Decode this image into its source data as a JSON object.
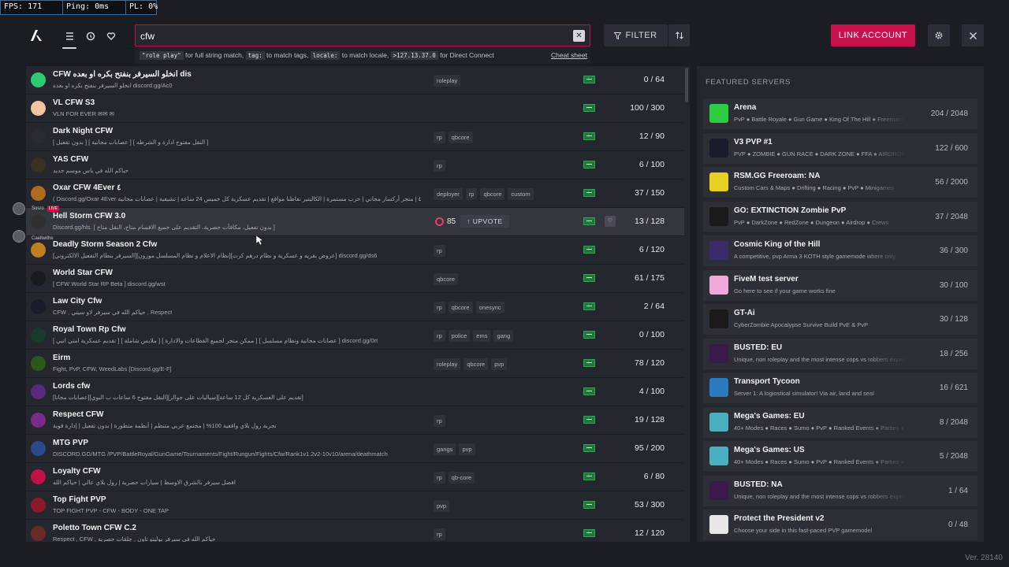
{
  "perf": {
    "fps": "FPS: 171",
    "ping": "Ping: 0ms",
    "pl": "PL: 0%"
  },
  "search": {
    "value": "cfw",
    "clear": "✕",
    "hints": {
      "q1": "\"role play\"",
      "t1": " for full string match, ",
      "q2": "tag:",
      "t2": " to match tags, ",
      "q3": "locale:",
      "t3": " to match locale, ",
      "q4": ">127.13.37.0",
      "t4": " for Direct Connect",
      "cheat": "Cheat sheet"
    }
  },
  "toolbar": {
    "filter": "FILTER",
    "link_account": "LINK ACCOUNT"
  },
  "servers": [
    {
      "name": "CFW انخلو السيرفر بنفتح بكره او بعده dis",
      "desc": "انخلو السيرفر بنفتح بكره او بعده discord.gg/Ac0",
      "tags": [
        "roleplay"
      ],
      "players": "0 / 64",
      "icon_color": "#2ecc71",
      "icon_name": "spade-icon"
    },
    {
      "name": "VL CFW S3",
      "desc": "VLN FOR EVER ✉✉ ✉",
      "tags": [],
      "players": "100 / 300",
      "icon_color": "#f0c8a0",
      "icon_name": "gradient-icon"
    },
    {
      "name": "Dark Night CFW",
      "desc": "[ بدون تفعيل ] [ عصابات مجانية ] [ النقل مفتوح ادارة و الشرطه ]",
      "tags": [
        "rp",
        "qbcore"
      ],
      "players": "12 / 90",
      "icon_color": "#2a2a30",
      "icon_name": "dn-logo-icon"
    },
    {
      "name": "YAS CFW",
      "desc": "حياكم الله في ياس موسم جديد",
      "tags": [
        "rp"
      ],
      "players": "6 / 100",
      "icon_color": "#3a3220",
      "icon_name": "yas-logo-icon"
    },
    {
      "name": "Oxar CFW 4Ever ٤",
      "desc": "( Discord.gg/Oxar 4Ever ٤ | متجر أركسار مجاني | حرب مستمرة | الكاليتير نقاطنا مواقع | تقديم عسكرية كل خميس 24 ساعة | تشيفية | عصابات مجانية",
      "tags": [
        "deployer",
        "rp",
        "qbcore",
        "custom"
      ],
      "players": "37 / 150",
      "icon_color": "#b06a20",
      "icon_name": "oxar-logo-icon"
    },
    {
      "name": "Hell Storm CFW 3.0",
      "desc": "Discord.gg/hls. [ بدون تفعيل، مكافأت حصرية، التقديم على جميع الاقسام متاح، النقل متاح ]",
      "tags": [],
      "players": "13 / 128",
      "icon_color": "#303030",
      "icon_name": "hellstorm-logo-icon",
      "boost": "85",
      "upvote": "UPVOTE",
      "highlight": true
    },
    {
      "name": "Deadly Storm Season 2 Cfw",
      "desc": "[السيرفر بنظام التفعيل الالكتروني][نظام الاعلام و نظام المسلسل موزون][عروض بقريه و عسكرية و نظام درهم كرت] discord.gg/ds6",
      "tags": [
        "rp"
      ],
      "players": "6 / 120",
      "icon_color": "#c08020",
      "icon_name": "deadly-storm-logo-icon"
    },
    {
      "name": "World Star CFW",
      "desc": "[ CFW World Star RP Beta ] discord.gg/wst",
      "tags": [
        "qbcore"
      ],
      "players": "61 / 175",
      "icon_color": "#1a1a1a",
      "icon_name": "world-star-logo-icon"
    },
    {
      "name": "Law City Cfw",
      "desc": "CFW , حياكم الله في سيرفر لاو سيتي , Respect",
      "tags": [
        "rp",
        "qbcore",
        "onesync"
      ],
      "players": "2 / 64",
      "icon_color": "#1a1a2a",
      "icon_name": "law-city-logo-icon"
    },
    {
      "name": "Royal Town Rp Cfw",
      "desc": "[ تقديم عسكرية امني انبي ] [ ملابس شاملة ] [ ممكن متجر لجميع القطاعات والادارة ] [ عصابات مجانية ونظام مسلسل ] discord.gg/0rt",
      "tags": [
        "rp",
        "police",
        "ems",
        "gang"
      ],
      "players": "0 / 100",
      "icon_color": "#1a3a2a",
      "icon_name": "royal-town-logo-icon"
    },
    {
      "name": "Eirm",
      "desc": "Fight, PvP, CFW, WeedLabs [Discord.gg/E-F]",
      "tags": [
        "roleplay",
        "qbcore",
        "pvp"
      ],
      "players": "78 / 120",
      "icon_color": "#2a5a1a",
      "icon_name": "eirm-logo-icon"
    },
    {
      "name": "Lords cfw",
      "desc": "[عصابات مجانا][النقل مفتوح 6 ساعات ب البوي][سياليات على جوالز][تقديم على العسكرية كل 12 ساعة]",
      "tags": [],
      "players": "4 / 100",
      "icon_color": "#5a2a7a",
      "icon_name": "lords-logo-icon"
    },
    {
      "name": "Respect CFW",
      "desc": "تجربة رول بلاي واقعية 100% | مجتمع عربي متنظم | أنظمة متطورة | بدون تفعيل | إدارة قوية",
      "tags": [
        "rp"
      ],
      "players": "19 / 128",
      "icon_color": "#7a2a8a",
      "icon_name": "respect-logo-icon"
    },
    {
      "name": "MTG PVP",
      "desc": "DISCORD.GG/MTG /PVP/BattleRoyal/GunGame/Tournaments/Fight/Rungun/Fights/Cfw/Rank1v1.2v2-10v10/arena/deathmatch",
      "tags": [
        "gangs",
        "pvp"
      ],
      "players": "95 / 200",
      "icon_color": "#2a4a8a",
      "icon_name": "mtg-logo-icon"
    },
    {
      "name": "Loyalty CFW",
      "desc": "افضل سيرفر بالشرق الاوسط | سيارات حصرية | رول بلاي عالي | حياكم الله",
      "tags": [
        "rp",
        "qb-core"
      ],
      "players": "6 / 80",
      "icon_color": "#c0104a",
      "icon_name": "loyalty-logo-icon"
    },
    {
      "name": "Top Fight PVP",
      "desc": "TOP FIGHT PVP - CFW - BODY - ONE TAP",
      "tags": [
        "pvp"
      ],
      "players": "53 / 300",
      "icon_color": "#8a1a2a",
      "icon_name": "top-fight-logo-icon"
    },
    {
      "name": "Poletto Town CFW C.2",
      "desc": "Respect , CFW , حياكم الله في سيرفر بوليتو تاون , جلقات حصرية",
      "tags": [
        "rp"
      ],
      "players": "12 / 120",
      "icon_color": "#6a2a2a",
      "icon_name": "poletto-logo-icon"
    }
  ],
  "featured": {
    "title": "FEATURED SERVERS",
    "items": [
      {
        "name": "Arena",
        "desc": "PvP ● Battle Royale ● Gun Game ● King Of The Hill ● Freeroam",
        "players": "204 / 2048",
        "icon_color": "#2ecc40",
        "icon_name": "arena-logo-icon"
      },
      {
        "name": "V3 PVP #1",
        "desc": "PVP ● ZOMBIE ● GUN RACE ● DARK ZONE ● FFA ● AIRDROP",
        "players": "122 / 600",
        "icon_color": "#1a1a2a",
        "icon_name": "v3-logo-icon"
      },
      {
        "name": "RSM.GG Freeroam: NA",
        "desc": "Custom Cars & Maps ● Drifting ● Racing ● PvP ● Minigames",
        "players": "56 / 2000",
        "icon_color": "#e8d020",
        "icon_name": "rsm-logo-icon"
      },
      {
        "name": "GO: EXTINCTION Zombie PvP",
        "desc": "PvP ● DarkZone ● RedZone ● Dungeon ● Airdrop ● Crews",
        "players": "37 / 2048",
        "icon_color": "#1a1a1a",
        "icon_name": "go-extinction-logo-icon"
      },
      {
        "name": "Cosmic King of the Hill",
        "desc": "A competitive, pvp Arma 3 KOTH style gamemode where only",
        "players": "36 / 300",
        "icon_color": "#3a2a6a",
        "icon_name": "cosmic-logo-icon"
      },
      {
        "name": "FiveM test server",
        "desc": "Go here to see if your game works fine",
        "players": "30 / 100",
        "icon_color": "#f0a8d8",
        "icon_name": "fivem-logo-icon"
      },
      {
        "name": "GT-Ai",
        "desc": "CyberZombie Apocalypse Survive Build PvE & PvP",
        "players": "30 / 128",
        "icon_color": "#1a1a1a",
        "icon_name": "gt-ai-logo-icon"
      },
      {
        "name": "BUSTED: EU",
        "desc": "Unique, non roleplay and the most intense cops vs robbers experience",
        "players": "18 / 256",
        "icon_color": "#3a1a4a",
        "icon_name": "busted-logo-icon"
      },
      {
        "name": "Transport Tycoon",
        "desc": "Server 1: A logiostical simulator! Via air, land and seal",
        "players": "16 / 621",
        "icon_color": "#2a7ac0",
        "icon_name": "transport-tycoon-logo-icon"
      },
      {
        "name": "Mega's Games: EU",
        "desc": "40+ Modes ● Races ● Sumo ● PvP ● Ranked Events ● Parties ●",
        "players": "8 / 2048",
        "icon_color": "#4ab0c0",
        "icon_name": "megas-games-logo-icon"
      },
      {
        "name": "Mega's Games: US",
        "desc": "40+ Modes ● Races ● Sumo ● PvP ● Ranked Events ● Parties ●",
        "players": "5 / 2048",
        "icon_color": "#4ab0c0",
        "icon_name": "megas-games-logo-icon"
      },
      {
        "name": "BUSTED: NA",
        "desc": "Unique, non roleplay and the most intense cops vs robbers experience",
        "players": "1 / 64",
        "icon_color": "#3a1a4a",
        "icon_name": "busted-logo-icon"
      },
      {
        "name": "Protect the President v2",
        "desc": "Choose your side in this fast-paced PVP gamemodel",
        "players": "0 / 48",
        "icon_color": "#e8e8e8",
        "icon_name": "protect-president-logo-icon"
      }
    ]
  },
  "voice": {
    "user1": "Sosro",
    "live": "LIVE",
    "user2": "Caellwithe"
  },
  "version": "Ver. 28140"
}
